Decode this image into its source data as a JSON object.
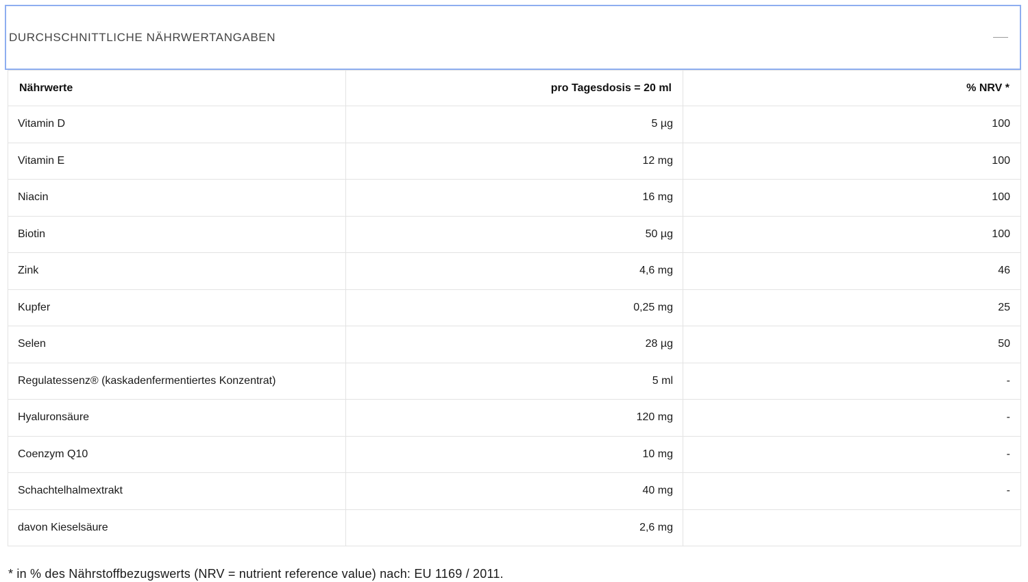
{
  "accordion": {
    "title": "DURCHSCHNITTLICHE NÄHRWERTANGABEN",
    "toggle_icon": "minus-icon"
  },
  "table": {
    "headers": [
      "Nährwerte",
      "pro Tagesdosis = 20 ml",
      "% NRV *"
    ],
    "rows": [
      {
        "name": "Vitamin D",
        "amount": "5 µg",
        "nrv": "100"
      },
      {
        "name": "Vitamin E",
        "amount": "12 mg",
        "nrv": "100"
      },
      {
        "name": "Niacin",
        "amount": "16 mg",
        "nrv": "100"
      },
      {
        "name": "Biotin",
        "amount": "50 µg",
        "nrv": "100"
      },
      {
        "name": "Zink",
        "amount": "4,6 mg",
        "nrv": "46"
      },
      {
        "name": "Kupfer",
        "amount": "0,25 mg",
        "nrv": "25"
      },
      {
        "name": "Selen",
        "amount": "28 µg",
        "nrv": "50"
      },
      {
        "name": "Regulatessenz® (kaskadenfermentiertes Konzentrat)",
        "amount": "5 ml",
        "nrv": "-"
      },
      {
        "name": "Hyaluronsäure",
        "amount": "120 mg",
        "nrv": "-"
      },
      {
        "name": "Coenzym Q10",
        "amount": "10 mg",
        "nrv": "-"
      },
      {
        "name": "Schachtelhalmextrakt",
        "amount": "40 mg",
        "nrv": "-"
      },
      {
        "name": "davon Kieselsäure",
        "amount": "2,6 mg",
        "nrv": ""
      }
    ]
  },
  "footnote": "* in % des Nährstoffbezugswerts (NRV = nutrient reference value) nach: EU 1169 / 2011.",
  "colors": {
    "focus_border": "#8eaef0",
    "table_border": "#e3e3e3"
  }
}
